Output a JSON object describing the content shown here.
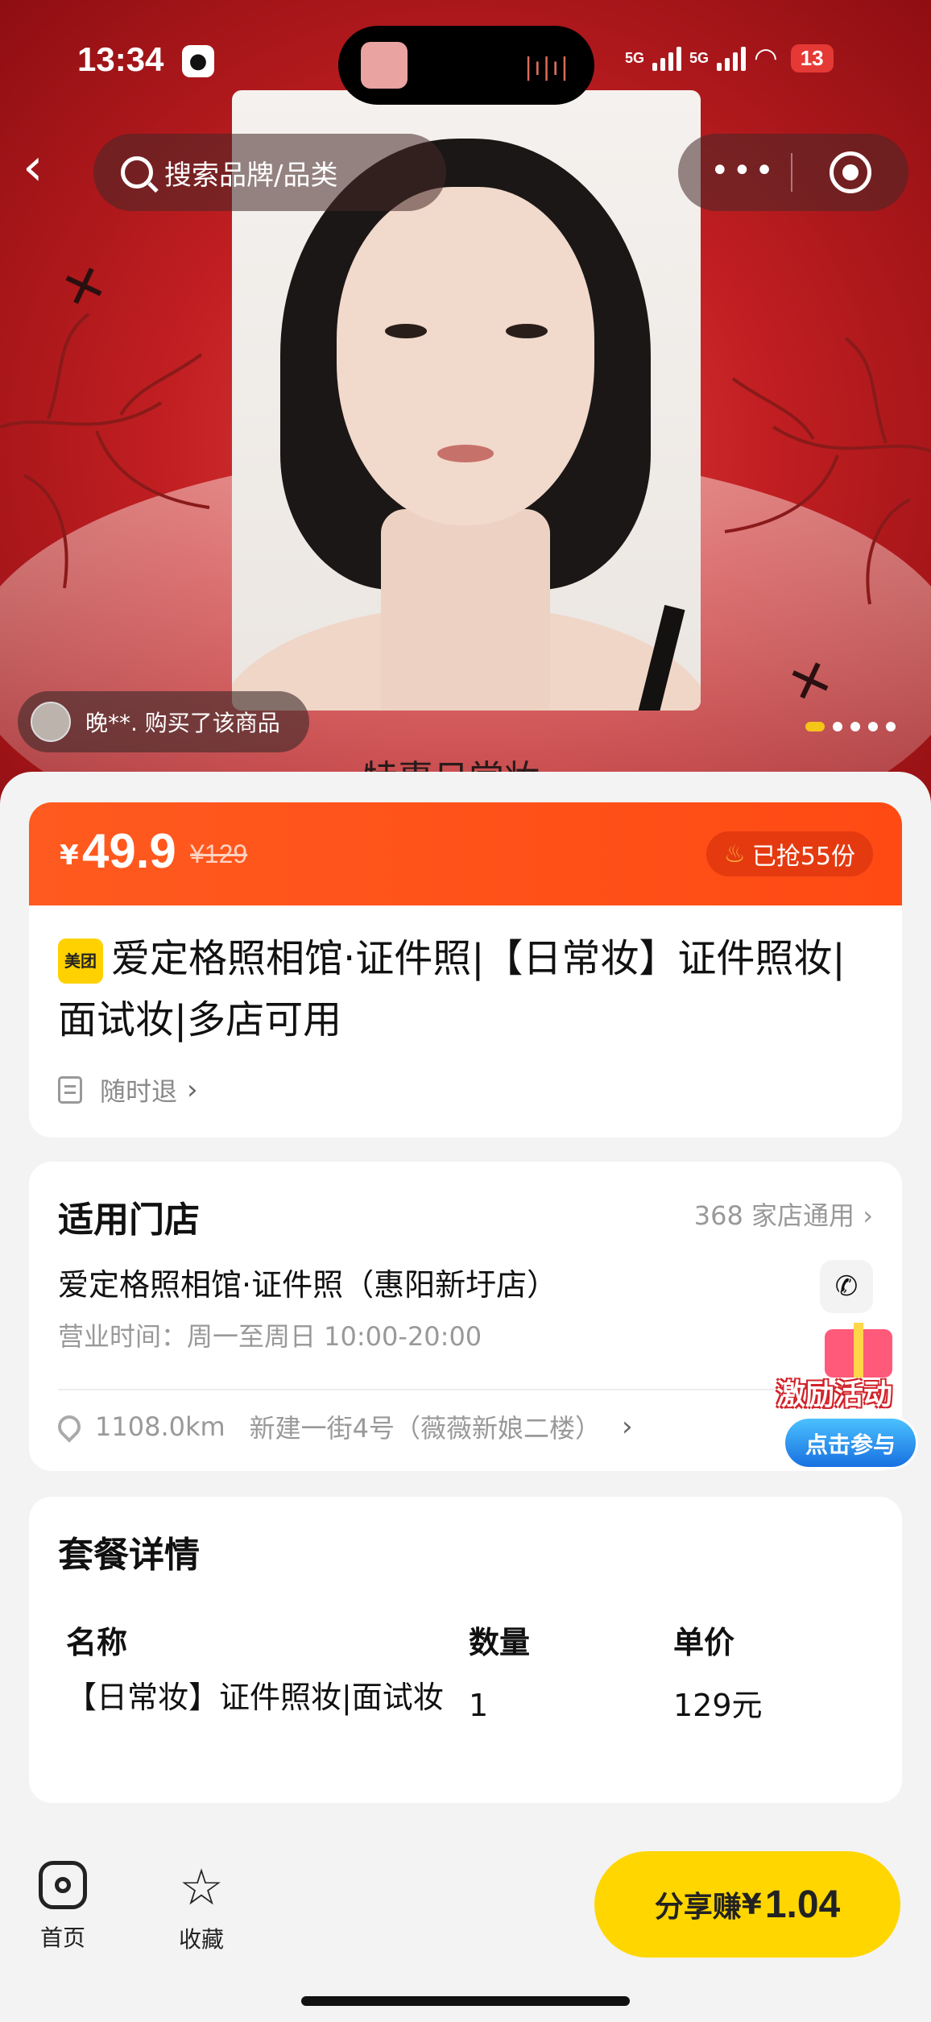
{
  "status_bar": {
    "time": "13:34",
    "signal_1": "5G",
    "signal_2": "5G",
    "wifi_sub": "6",
    "battery": "13"
  },
  "header": {
    "search_placeholder": "搜索品牌/品类"
  },
  "hero": {
    "buyer_notice": "晚**. 购买了该商品",
    "caption": "特惠日常妆",
    "slide_count": 5,
    "active_slide": 1
  },
  "price": {
    "currency": "¥",
    "current": "49.9",
    "original": "¥129",
    "sold": "已抢55份"
  },
  "product": {
    "brand_badge": "美团",
    "title": "爱定格照相馆·证件照|【日常妆】证件照妆|面试妆|多店可用",
    "refund_label": "随时退"
  },
  "store": {
    "section_title": "适用门店",
    "count_label": "368 家店通用",
    "name": "爱定格照相馆·证件照（惠阳新圩店）",
    "hours": "营业时间：周一至周日 10:00-20:00",
    "distance": "1108.0km",
    "address": "新建一街4号（薇薇新娘二楼）",
    "phone_label": "电话"
  },
  "promo": {
    "title": "激励活动",
    "button": "点击参与"
  },
  "package": {
    "section_title": "套餐详情",
    "columns": [
      "名称",
      "数量",
      "单价"
    ],
    "rows": [
      {
        "name": "【日常妆】证件照妆|面试妆",
        "qty": "1",
        "price": "129元"
      }
    ]
  },
  "bottom_nav": {
    "home_label": "首页",
    "fav_label": "收藏",
    "share_label": "分享赚",
    "share_currency": "¥",
    "share_amount": "1.04"
  },
  "colors": {
    "accent_orange": "#ff5a1f",
    "share_yellow": "#ffd600",
    "hero_red": "#c21f22"
  }
}
